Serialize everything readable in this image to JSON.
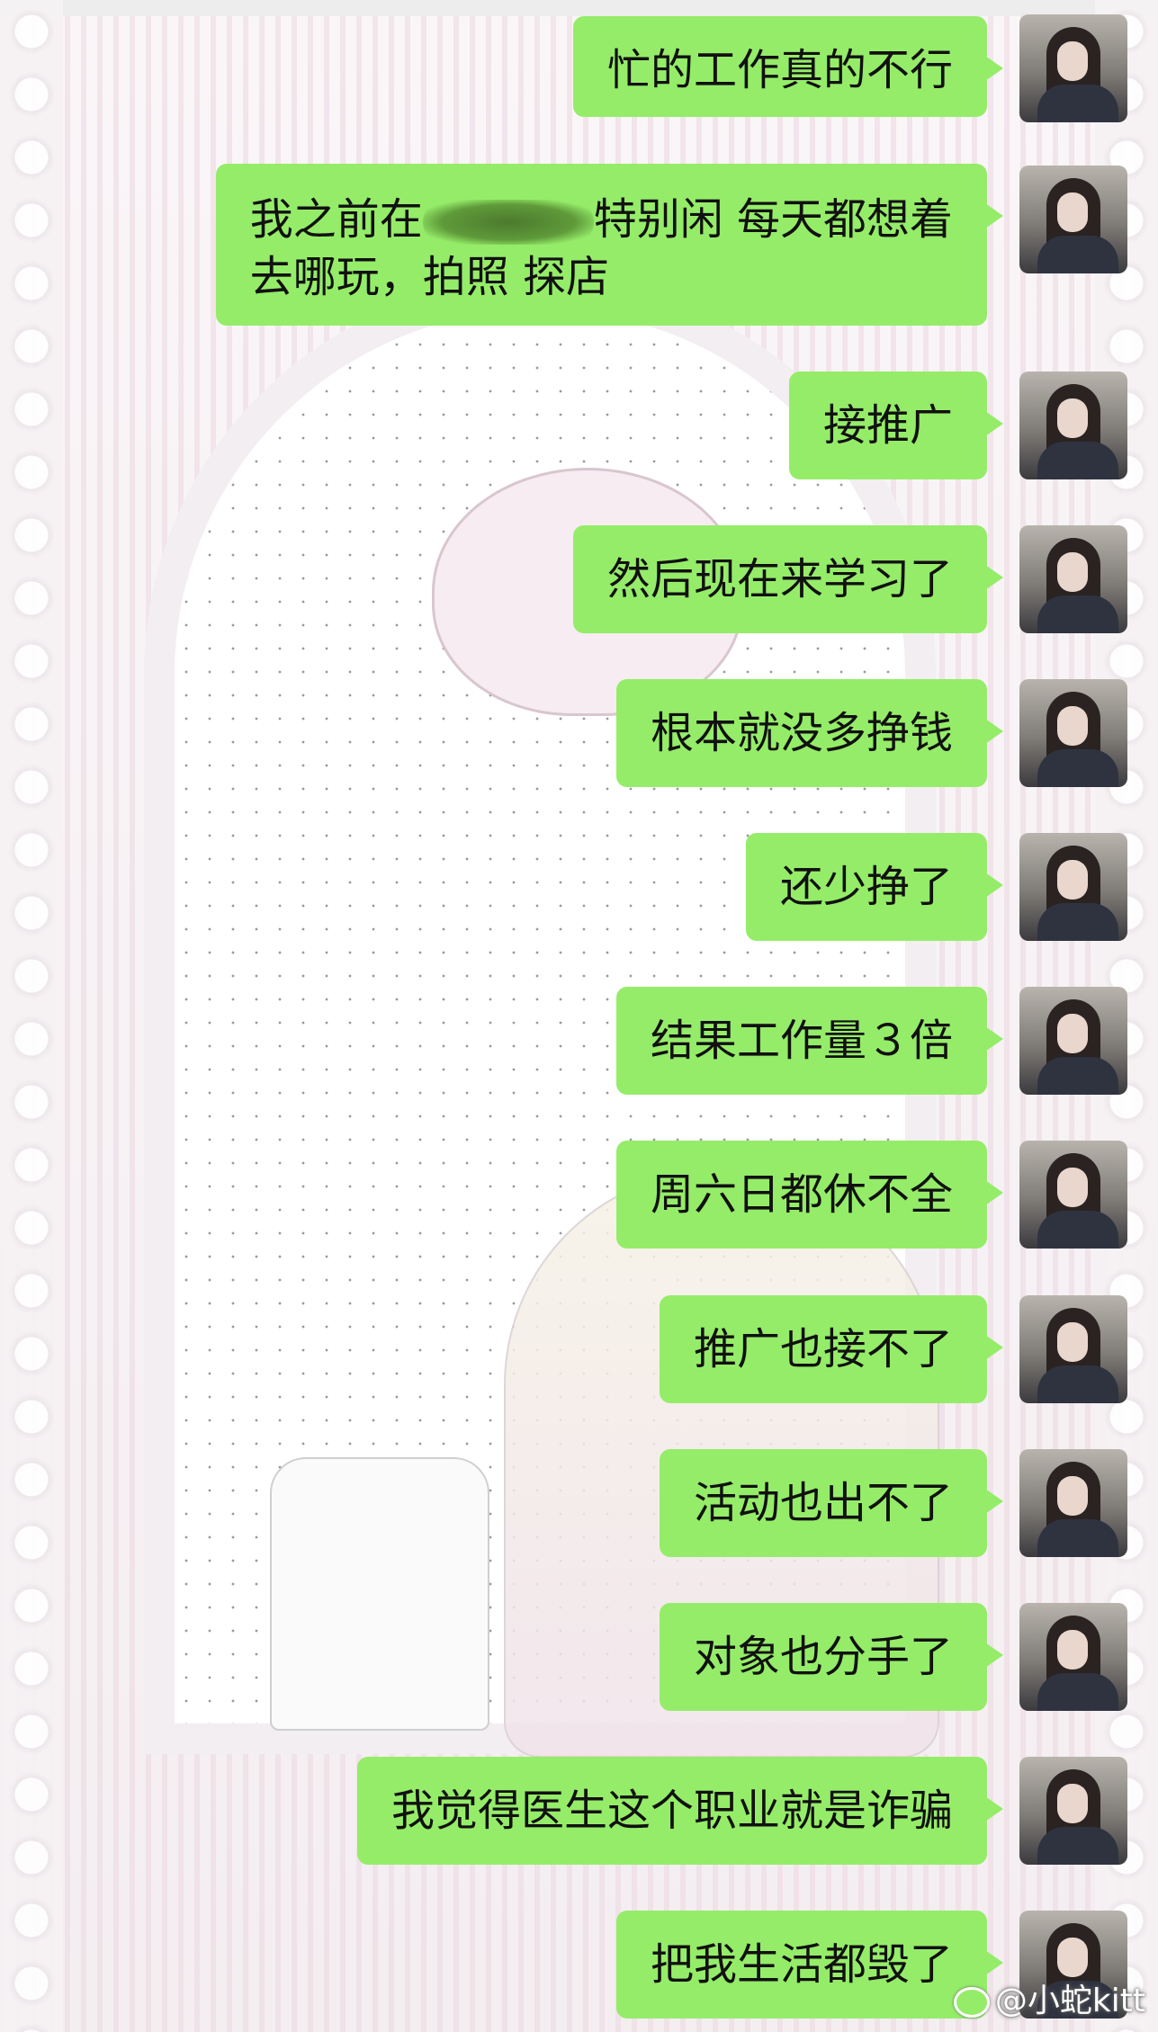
{
  "chat": {
    "messages": [
      {
        "parts": [
          "忙的工作真的不行"
        ]
      },
      {
        "parts": [
          "我之前在",
          "特别闲 每天都想着",
          "去哪玩，拍照 探店"
        ]
      },
      {
        "parts": [
          "接推广"
        ]
      },
      {
        "parts": [
          "然后现在来学习了"
        ]
      },
      {
        "parts": [
          "根本就没多挣钱"
        ]
      },
      {
        "parts": [
          "还少挣了"
        ]
      },
      {
        "parts": [
          "结果工作量３倍"
        ]
      },
      {
        "parts": [
          "周六日都休不全"
        ]
      },
      {
        "parts": [
          "推广也接不了"
        ]
      },
      {
        "parts": [
          "活动也出不了"
        ]
      },
      {
        "parts": [
          "对象也分手了"
        ]
      },
      {
        "parts": [
          "我觉得医生这个职业就是诈骗"
        ]
      },
      {
        "parts": [
          "把我生活都毁了"
        ]
      }
    ]
  },
  "watermark": {
    "text": "@小蛇kitt"
  },
  "colors": {
    "bubble": "#95ec69",
    "background": "#f7f3f5"
  },
  "icons": {
    "avatar": "user-avatar-photo",
    "watermark": "weibo-logo-icon"
  }
}
